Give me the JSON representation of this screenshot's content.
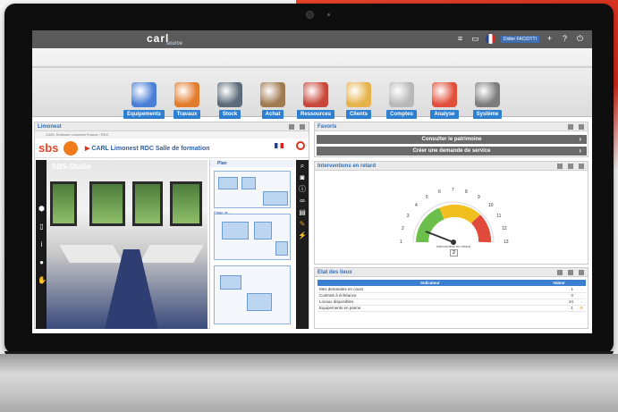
{
  "app": {
    "logo": "carl",
    "logo_sub": "source",
    "user": "Didier FACIOTTI"
  },
  "modules": [
    {
      "label": "Equipements",
      "icon": "equipment-icon",
      "color": "#4a7fd6"
    },
    {
      "label": "Travaux",
      "icon": "works-icon",
      "color": "#e37b2c"
    },
    {
      "label": "Stock",
      "icon": "stock-icon",
      "color": "#5b6b7a"
    },
    {
      "label": "Achat",
      "icon": "cart-icon",
      "color": "#a07a50"
    },
    {
      "label": "Ressources",
      "icon": "people-icon",
      "color": "#c9473a"
    },
    {
      "label": "Clients",
      "icon": "box-icon",
      "color": "#e6b24a"
    },
    {
      "label": "Comptes",
      "icon": "documents-icon",
      "color": "#b8b8b8"
    },
    {
      "label": "Analyse",
      "icon": "chart-icon",
      "color": "#e14e3a"
    },
    {
      "label": "Système",
      "icon": "gears-icon",
      "color": "#7d7d7d"
    }
  ],
  "left_panel": {
    "title": "Limonest",
    "crumbs": "CARL Software Limonest France  ›  RDC",
    "location": "CARL Limonest  RDC  Salle de formation",
    "viewer_label": "SBS-Studio",
    "plan_title": "Plan",
    "plan_captions": [
      "Etage de ..."
    ]
  },
  "favoris": {
    "title": "Favoris",
    "buttons": [
      "Consulter le patrimoine",
      "Créer une demande de service"
    ]
  },
  "interventions": {
    "title": "Interventions en retard",
    "gauge_label": "Intervention en retard",
    "gauge_value": "2",
    "ticks": [
      "1",
      "2",
      "3",
      "4",
      "5",
      "6",
      "7",
      "8",
      "9",
      "10",
      "11",
      "12",
      "13"
    ]
  },
  "etat": {
    "title": "Etat des lieux",
    "col_indicator": "Indicateur",
    "col_value": "Valeur",
    "rows": [
      {
        "label": "Mes demandes en cours",
        "value": "1",
        "warn": false
      },
      {
        "label": "Contrats à échéance",
        "value": "0",
        "warn": false
      },
      {
        "label": "Locaux disponibles",
        "value": "24",
        "warn": false
      },
      {
        "label": "Equipements en panne",
        "value": "1",
        "warn": true
      }
    ]
  },
  "colors": {
    "accent_blue": "#2f7fd0",
    "brand_red": "#d9331f",
    "gauge_green": "#6cbf4a",
    "gauge_yellow": "#f2c01e",
    "gauge_red": "#e14a3a"
  }
}
